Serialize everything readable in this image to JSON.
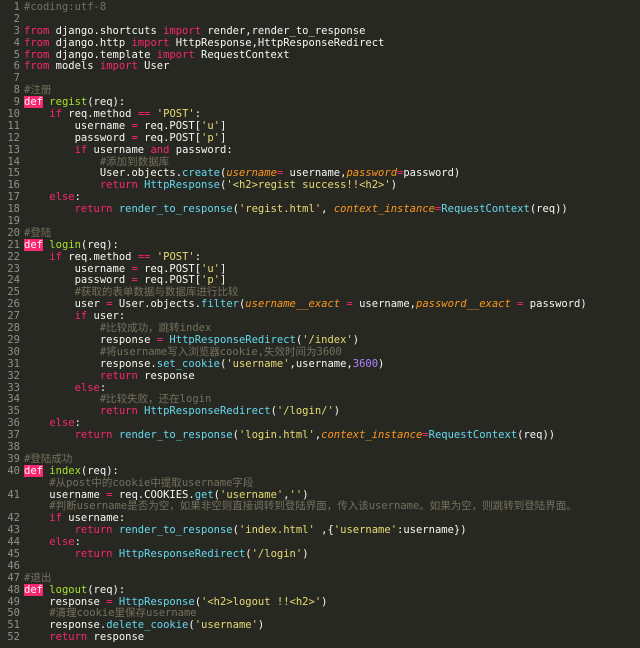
{
  "editor": {
    "lines": [
      {
        "n": "1",
        "segs": [
          [
            "com",
            "#coding:utf-8"
          ]
        ]
      },
      {
        "n": "2",
        "segs": []
      },
      {
        "n": "3",
        "segs": [
          [
            "kw",
            "from"
          ],
          [
            "txt",
            " django.shortcuts "
          ],
          [
            "kw",
            "import"
          ],
          [
            "txt",
            " render,render_to_response"
          ]
        ]
      },
      {
        "n": "4",
        "segs": [
          [
            "kw",
            "from"
          ],
          [
            "txt",
            " django.http "
          ],
          [
            "kw",
            "import"
          ],
          [
            "txt",
            " HttpResponse,HttpResponseRedirect"
          ]
        ]
      },
      {
        "n": "5",
        "segs": [
          [
            "kw",
            "from"
          ],
          [
            "txt",
            " django.template "
          ],
          [
            "kw",
            "import"
          ],
          [
            "txt",
            " RequestContext"
          ]
        ]
      },
      {
        "n": "6",
        "segs": [
          [
            "kw",
            "from"
          ],
          [
            "txt",
            " models "
          ],
          [
            "kw",
            "import"
          ],
          [
            "txt",
            " User"
          ]
        ]
      },
      {
        "n": "7",
        "segs": []
      },
      {
        "n": "8",
        "segs": [
          [
            "com",
            "#注册"
          ]
        ]
      },
      {
        "n": "9",
        "segs": [
          [
            "def",
            "def"
          ],
          [
            "txt",
            " "
          ],
          [
            "fn",
            "regist"
          ],
          [
            "txt",
            "(req):"
          ]
        ]
      },
      {
        "n": "10",
        "segs": [
          [
            "txt",
            "    "
          ],
          [
            "kw",
            "if"
          ],
          [
            "txt",
            " req.method "
          ],
          [
            "kw",
            "=="
          ],
          [
            "txt",
            " "
          ],
          [
            "str",
            "'POST'"
          ],
          [
            "txt",
            ":"
          ]
        ]
      },
      {
        "n": "11",
        "segs": [
          [
            "txt",
            "        username "
          ],
          [
            "kw",
            "="
          ],
          [
            "txt",
            " req.POST["
          ],
          [
            "str",
            "'u'"
          ],
          [
            "txt",
            "]"
          ]
        ]
      },
      {
        "n": "12",
        "segs": [
          [
            "txt",
            "        password "
          ],
          [
            "kw",
            "="
          ],
          [
            "txt",
            " req.POST["
          ],
          [
            "str",
            "'p'"
          ],
          [
            "txt",
            "]"
          ]
        ]
      },
      {
        "n": "13",
        "segs": [
          [
            "txt",
            "        "
          ],
          [
            "kw",
            "if"
          ],
          [
            "txt",
            " username "
          ],
          [
            "kw",
            "and"
          ],
          [
            "txt",
            " password:"
          ]
        ]
      },
      {
        "n": "14",
        "segs": [
          [
            "txt",
            "            "
          ],
          [
            "com",
            "#添加到数据库"
          ]
        ]
      },
      {
        "n": "15",
        "segs": [
          [
            "txt",
            "            User.objects."
          ],
          [
            "call",
            "create"
          ],
          [
            "txt",
            "("
          ],
          [
            "param",
            "username"
          ],
          [
            "kw",
            "="
          ],
          [
            "txt",
            " username,"
          ],
          [
            "param",
            "password"
          ],
          [
            "kw",
            "="
          ],
          [
            "txt",
            "password)"
          ]
        ]
      },
      {
        "n": "16",
        "segs": [
          [
            "txt",
            "            "
          ],
          [
            "kw",
            "return"
          ],
          [
            "txt",
            " "
          ],
          [
            "call",
            "HttpResponse"
          ],
          [
            "txt",
            "("
          ],
          [
            "str",
            "'<h2>regist success!!<h2>'"
          ],
          [
            "txt",
            ")"
          ]
        ]
      },
      {
        "n": "17",
        "segs": [
          [
            "txt",
            "    "
          ],
          [
            "kw",
            "else"
          ],
          [
            "txt",
            ":"
          ]
        ]
      },
      {
        "n": "18",
        "segs": [
          [
            "txt",
            "        "
          ],
          [
            "kw",
            "return"
          ],
          [
            "txt",
            " "
          ],
          [
            "call",
            "render_to_response"
          ],
          [
            "txt",
            "("
          ],
          [
            "str",
            "'regist.html'"
          ],
          [
            "txt",
            ", "
          ],
          [
            "param",
            "context_instance"
          ],
          [
            "kw",
            "="
          ],
          [
            "call",
            "RequestContext"
          ],
          [
            "txt",
            "(req))"
          ]
        ]
      },
      {
        "n": "19",
        "segs": []
      },
      {
        "n": "20",
        "segs": [
          [
            "com",
            "#登陆"
          ]
        ]
      },
      {
        "n": "21",
        "segs": [
          [
            "def",
            "def"
          ],
          [
            "txt",
            " "
          ],
          [
            "fn",
            "login"
          ],
          [
            "txt",
            "(req):"
          ]
        ]
      },
      {
        "n": "22",
        "segs": [
          [
            "txt",
            "    "
          ],
          [
            "kw",
            "if"
          ],
          [
            "txt",
            " req.method "
          ],
          [
            "kw",
            "=="
          ],
          [
            "txt",
            " "
          ],
          [
            "str",
            "'POST'"
          ],
          [
            "txt",
            ":"
          ]
        ]
      },
      {
        "n": "23",
        "segs": [
          [
            "txt",
            "        username "
          ],
          [
            "kw",
            "="
          ],
          [
            "txt",
            " req.POST["
          ],
          [
            "str",
            "'u'"
          ],
          [
            "txt",
            "]"
          ]
        ]
      },
      {
        "n": "24",
        "segs": [
          [
            "txt",
            "        password "
          ],
          [
            "kw",
            "="
          ],
          [
            "txt",
            " req.POST["
          ],
          [
            "str",
            "'p'"
          ],
          [
            "txt",
            "]"
          ]
        ]
      },
      {
        "n": "25",
        "segs": [
          [
            "txt",
            "        "
          ],
          [
            "com",
            "#获取的表单数据与数据库进行比较"
          ]
        ]
      },
      {
        "n": "26",
        "segs": [
          [
            "txt",
            "        user "
          ],
          [
            "kw",
            "="
          ],
          [
            "txt",
            " User.objects."
          ],
          [
            "call",
            "filter"
          ],
          [
            "txt",
            "("
          ],
          [
            "param",
            "username__exact"
          ],
          [
            "txt",
            " "
          ],
          [
            "kw",
            "="
          ],
          [
            "txt",
            " username,"
          ],
          [
            "param",
            "password__exact"
          ],
          [
            "txt",
            " "
          ],
          [
            "kw",
            "="
          ],
          [
            "txt",
            " password)"
          ]
        ]
      },
      {
        "n": "27",
        "segs": [
          [
            "txt",
            "        "
          ],
          [
            "kw",
            "if"
          ],
          [
            "txt",
            " user:"
          ]
        ]
      },
      {
        "n": "28",
        "segs": [
          [
            "txt",
            "            "
          ],
          [
            "com",
            "#比较成功，跳转index"
          ]
        ]
      },
      {
        "n": "29",
        "segs": [
          [
            "txt",
            "            response "
          ],
          [
            "kw",
            "="
          ],
          [
            "txt",
            " "
          ],
          [
            "call",
            "HttpResponseRedirect"
          ],
          [
            "txt",
            "("
          ],
          [
            "str",
            "'/index'"
          ],
          [
            "txt",
            ")"
          ]
        ]
      },
      {
        "n": "30",
        "segs": [
          [
            "txt",
            "            "
          ],
          [
            "com",
            "#将username写入浏览器cookie,失效时间为3600"
          ]
        ]
      },
      {
        "n": "31",
        "segs": [
          [
            "txt",
            "            response."
          ],
          [
            "call",
            "set_cookie"
          ],
          [
            "txt",
            "("
          ],
          [
            "str",
            "'username'"
          ],
          [
            "txt",
            ",username,"
          ],
          [
            "num",
            "3600"
          ],
          [
            "txt",
            ")"
          ]
        ]
      },
      {
        "n": "32",
        "segs": [
          [
            "txt",
            "            "
          ],
          [
            "kw",
            "return"
          ],
          [
            "txt",
            " response"
          ]
        ]
      },
      {
        "n": "33",
        "segs": [
          [
            "txt",
            "        "
          ],
          [
            "kw",
            "else"
          ],
          [
            "txt",
            ":"
          ]
        ]
      },
      {
        "n": "34",
        "segs": [
          [
            "txt",
            "            "
          ],
          [
            "com",
            "#比较失败，还在login"
          ]
        ]
      },
      {
        "n": "35",
        "segs": [
          [
            "txt",
            "            "
          ],
          [
            "kw",
            "return"
          ],
          [
            "txt",
            " "
          ],
          [
            "call",
            "HttpResponseRedirect"
          ],
          [
            "txt",
            "("
          ],
          [
            "str",
            "'/login/'"
          ],
          [
            "txt",
            ")"
          ]
        ]
      },
      {
        "n": "36",
        "segs": [
          [
            "txt",
            "    "
          ],
          [
            "kw",
            "else"
          ],
          [
            "txt",
            ":"
          ]
        ]
      },
      {
        "n": "37",
        "segs": [
          [
            "txt",
            "        "
          ],
          [
            "kw",
            "return"
          ],
          [
            "txt",
            " "
          ],
          [
            "call",
            "render_to_response"
          ],
          [
            "txt",
            "("
          ],
          [
            "str",
            "'login.html'"
          ],
          [
            "txt",
            ","
          ],
          [
            "param",
            "context_instance"
          ],
          [
            "kw",
            "="
          ],
          [
            "call",
            "RequestContext"
          ],
          [
            "txt",
            "(req))"
          ]
        ]
      },
      {
        "n": "38",
        "segs": []
      },
      {
        "n": "39",
        "segs": [
          [
            "com",
            "#登陆成功"
          ]
        ]
      },
      {
        "n": "40",
        "segs": [
          [
            "def",
            "def"
          ],
          [
            "txt",
            " "
          ],
          [
            "fn",
            "index"
          ],
          [
            "txt",
            "(req):"
          ]
        ]
      },
      {
        "n": "",
        "segs": [
          [
            "txt",
            "    "
          ],
          [
            "com",
            "#从post中的cookie中提取username字段"
          ]
        ]
      },
      {
        "n": "41",
        "segs": [
          [
            "txt",
            "    username "
          ],
          [
            "kw",
            "="
          ],
          [
            "txt",
            " req.COOKIES."
          ],
          [
            "call",
            "get"
          ],
          [
            "txt",
            "("
          ],
          [
            "str",
            "'username'"
          ],
          [
            "txt",
            ","
          ],
          [
            "str",
            "''"
          ],
          [
            "txt",
            ")"
          ]
        ]
      },
      {
        "n": "",
        "segs": [
          [
            "txt",
            "    "
          ],
          [
            "com",
            "#判断username是否为空，如果非空则直接调转到登陆界面，传入该username。如果为空，则跳转到登陆界面。"
          ]
        ]
      },
      {
        "n": "42",
        "segs": [
          [
            "txt",
            "    "
          ],
          [
            "kw",
            "if"
          ],
          [
            "txt",
            " username:"
          ]
        ]
      },
      {
        "n": "43",
        "segs": [
          [
            "txt",
            "        "
          ],
          [
            "kw",
            "return"
          ],
          [
            "txt",
            " "
          ],
          [
            "call",
            "render_to_response"
          ],
          [
            "txt",
            "("
          ],
          [
            "str",
            "'index.html'"
          ],
          [
            "txt",
            " ,{"
          ],
          [
            "str",
            "'username'"
          ],
          [
            "txt",
            ":username})"
          ]
        ]
      },
      {
        "n": "44",
        "segs": [
          [
            "txt",
            "    "
          ],
          [
            "kw",
            "else"
          ],
          [
            "txt",
            ":"
          ]
        ]
      },
      {
        "n": "45",
        "segs": [
          [
            "txt",
            "        "
          ],
          [
            "kw",
            "return"
          ],
          [
            "txt",
            " "
          ],
          [
            "call",
            "HttpResponseRedirect"
          ],
          [
            "txt",
            "("
          ],
          [
            "str",
            "'/login'"
          ],
          [
            "txt",
            ")"
          ]
        ]
      },
      {
        "n": "46",
        "segs": []
      },
      {
        "n": "47",
        "segs": [
          [
            "com",
            "#退出"
          ]
        ]
      },
      {
        "n": "48",
        "segs": [
          [
            "def",
            "def"
          ],
          [
            "txt",
            " "
          ],
          [
            "fn",
            "logout"
          ],
          [
            "txt",
            "(req):"
          ]
        ]
      },
      {
        "n": "49",
        "segs": [
          [
            "txt",
            "    response "
          ],
          [
            "kw",
            "="
          ],
          [
            "txt",
            " "
          ],
          [
            "call",
            "HttpResponse"
          ],
          [
            "txt",
            "("
          ],
          [
            "str",
            "'<h2>logout !!<h2>'"
          ],
          [
            "txt",
            ")"
          ]
        ]
      },
      {
        "n": "50",
        "segs": [
          [
            "txt",
            "    "
          ],
          [
            "com",
            "#清理cookie里保存username"
          ]
        ]
      },
      {
        "n": "51",
        "segs": [
          [
            "txt",
            "    response."
          ],
          [
            "call",
            "delete_cookie"
          ],
          [
            "txt",
            "("
          ],
          [
            "str",
            "'username'"
          ],
          [
            "txt",
            ")"
          ]
        ]
      },
      {
        "n": "52",
        "segs": [
          [
            "txt",
            "    "
          ],
          [
            "kw",
            "return"
          ],
          [
            "txt",
            " response"
          ]
        ]
      }
    ]
  }
}
